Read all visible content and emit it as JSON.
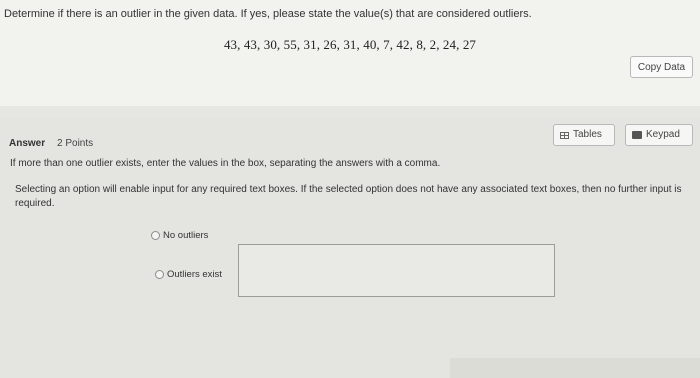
{
  "question": {
    "text": "Determine if there is an outlier in the given data. If yes, please state the value(s) that are considered outliers.",
    "data_values": "43, 43, 30, 55, 31, 26, 31, 40, 7, 42, 8, 2, 24, 27",
    "copy_button_label": "Copy Data"
  },
  "answer": {
    "label": "Answer",
    "points": "2 Points",
    "tables_label": "Tables",
    "keypad_label": "Keypad",
    "instruction_1": "If more than one outlier exists, enter the values in the box, separating the answers with a comma.",
    "instruction_2": "Selecting an option will enable input for any required text boxes. If the selected option does not have any associated text boxes, then no further input is required.",
    "options": [
      {
        "label": "No outliers"
      },
      {
        "label": "Outliers exist"
      }
    ],
    "input_value": ""
  }
}
